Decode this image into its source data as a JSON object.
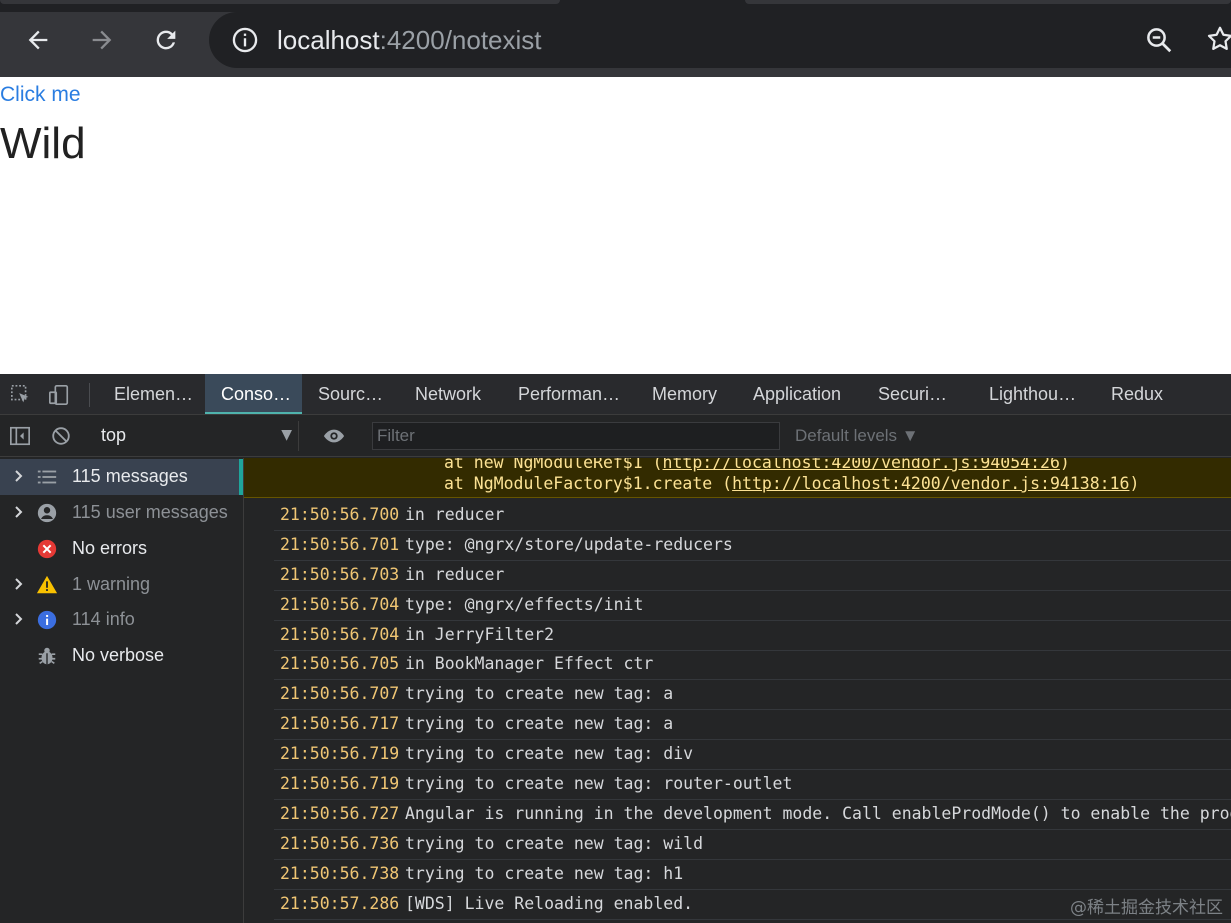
{
  "browser": {
    "url_host": "localhost",
    "url_rest": ":4200/notexist"
  },
  "page": {
    "link_text": "Click me",
    "heading": "Wild"
  },
  "devtools": {
    "tabs": [
      {
        "label": "Elemen…",
        "active": false
      },
      {
        "label": "Conso…",
        "active": true
      },
      {
        "label": "Sourc…",
        "active": false
      },
      {
        "label": "Network",
        "active": false
      },
      {
        "label": "Performan…",
        "active": false
      },
      {
        "label": "Memory",
        "active": false
      },
      {
        "label": "Application",
        "active": false
      },
      {
        "label": "Securi…",
        "active": false
      },
      {
        "label": "Lighthou…",
        "active": false
      },
      {
        "label": "Redux",
        "active": false
      }
    ],
    "toolbar": {
      "context": "top",
      "filter_placeholder": "Filter",
      "levels": "Default levels ▼"
    },
    "sidebar": [
      {
        "label": "115 messages",
        "icon": "list-icon",
        "selected": true
      },
      {
        "label": "115 user messages",
        "icon": "user-icon",
        "selected": false
      },
      {
        "label": "No errors",
        "icon": "error-icon",
        "selected": false
      },
      {
        "label": "1 warning",
        "icon": "warning-icon",
        "selected": false
      },
      {
        "label": "114 info",
        "icon": "info-icon",
        "selected": false
      },
      {
        "label": "No verbose",
        "icon": "bug-icon",
        "selected": false
      }
    ],
    "trace": [
      {
        "prefix": "at new NgModuleRef$1 (",
        "link": "http://localhost:4200/vendor.js:94054:26",
        "suffix": ")"
      },
      {
        "prefix": "at NgModuleFactory$1.create (",
        "link": "http://localhost:4200/vendor.js:94138:16",
        "suffix": ")"
      }
    ],
    "logs": [
      {
        "time": "21:50:56.700",
        "msg": "in reducer"
      },
      {
        "time": "21:50:56.701",
        "msg": "type: @ngrx/store/update-reducers"
      },
      {
        "time": "21:50:56.703",
        "msg": "in reducer"
      },
      {
        "time": "21:50:56.704",
        "msg": "type: @ngrx/effects/init"
      },
      {
        "time": "21:50:56.704",
        "msg": "in JerryFilter2"
      },
      {
        "time": "21:50:56.705",
        "msg": "in BookManager Effect ctr"
      },
      {
        "time": "21:50:56.707",
        "msg": "trying to create new tag: a"
      },
      {
        "time": "21:50:56.717",
        "msg": "trying to create new tag: a"
      },
      {
        "time": "21:50:56.719",
        "msg": "trying to create new tag: div"
      },
      {
        "time": "21:50:56.719",
        "msg": "trying to create new tag: router-outlet"
      },
      {
        "time": "21:50:56.727",
        "msg": "Angular is running in the development mode. Call enableProdMode() to enable the production mode."
      },
      {
        "time": "21:50:56.736",
        "msg": "trying to create new tag: wild"
      },
      {
        "time": "21:50:56.738",
        "msg": "trying to create new tag: h1"
      },
      {
        "time": "21:50:57.286",
        "msg": "[WDS] Live Reloading enabled."
      }
    ]
  },
  "watermark": "@稀土掘金技术社区",
  "colors": {
    "chrome": "#35363a",
    "omnibox": "#202124",
    "link": "#2a7de1",
    "devtools_bg": "#242526",
    "active_tab_underline": "#4fb3ad",
    "timestamp": "#f0c674",
    "warning_text": "#fce294"
  }
}
